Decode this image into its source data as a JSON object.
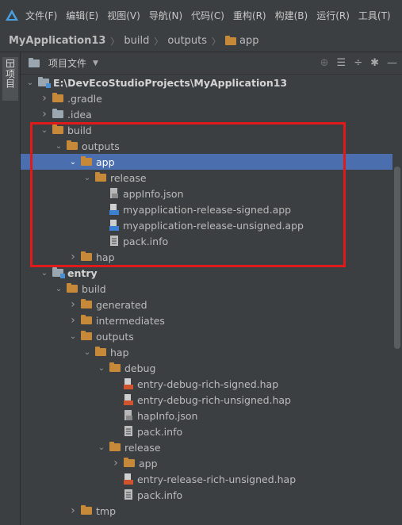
{
  "menu": [
    "文件(F)",
    "编辑(E)",
    "视图(V)",
    "导航(N)",
    "代码(C)",
    "重构(R)",
    "构建(B)",
    "运行(R)",
    "工具(T)"
  ],
  "breadcrumb": {
    "project": "MyApplication13",
    "items": [
      "build",
      "outputs",
      "app"
    ]
  },
  "sidebar": {
    "tab_label": "项目"
  },
  "panel": {
    "title": "项目文件"
  },
  "tree": [
    {
      "label": "E:\\DevEcoStudioProjects\\MyApplication13",
      "level": 0,
      "expanded": true,
      "icon": "module-folder",
      "bold": true
    },
    {
      "label": ".gradle",
      "level": 1,
      "expanded": false,
      "icon": "folder"
    },
    {
      "label": ".idea",
      "level": 1,
      "expanded": false,
      "icon": "folder-gray"
    },
    {
      "label": "build",
      "level": 1,
      "expanded": true,
      "icon": "folder"
    },
    {
      "label": "outputs",
      "level": 2,
      "expanded": true,
      "icon": "folder"
    },
    {
      "label": "app",
      "level": 3,
      "expanded": true,
      "icon": "folder",
      "selected": true
    },
    {
      "label": "release",
      "level": 4,
      "expanded": true,
      "icon": "folder"
    },
    {
      "label": "appInfo.json",
      "level": 5,
      "icon": "json-file"
    },
    {
      "label": "myapplication-release-signed.app",
      "level": 5,
      "icon": "app-file"
    },
    {
      "label": "myapplication-release-unsigned.app",
      "level": 5,
      "icon": "app-file"
    },
    {
      "label": "pack.info",
      "level": 5,
      "icon": "text-file"
    },
    {
      "label": "hap",
      "level": 3,
      "expanded": false,
      "icon": "folder"
    },
    {
      "label": "entry",
      "level": 1,
      "expanded": true,
      "icon": "module-folder",
      "bold": true
    },
    {
      "label": "build",
      "level": 2,
      "expanded": true,
      "icon": "folder"
    },
    {
      "label": "generated",
      "level": 3,
      "expanded": false,
      "icon": "folder"
    },
    {
      "label": "intermediates",
      "level": 3,
      "expanded": false,
      "icon": "folder"
    },
    {
      "label": "outputs",
      "level": 3,
      "expanded": true,
      "icon": "folder"
    },
    {
      "label": "hap",
      "level": 4,
      "expanded": true,
      "icon": "folder"
    },
    {
      "label": "debug",
      "level": 5,
      "expanded": true,
      "icon": "folder"
    },
    {
      "label": "entry-debug-rich-signed.hap",
      "level": 6,
      "icon": "hap-file"
    },
    {
      "label": "entry-debug-rich-unsigned.hap",
      "level": 6,
      "icon": "hap-file"
    },
    {
      "label": "hapInfo.json",
      "level": 6,
      "icon": "json-file"
    },
    {
      "label": "pack.info",
      "level": 6,
      "icon": "text-file"
    },
    {
      "label": "release",
      "level": 5,
      "expanded": true,
      "icon": "folder"
    },
    {
      "label": "app",
      "level": 6,
      "expanded": false,
      "icon": "folder"
    },
    {
      "label": "entry-release-rich-unsigned.hap",
      "level": 6,
      "icon": "hap-file"
    },
    {
      "label": "pack.info",
      "level": 6,
      "icon": "text-file"
    },
    {
      "label": "tmp",
      "level": 3,
      "expanded": false,
      "icon": "folder"
    }
  ],
  "colors": {
    "selection": "#4b6eaf",
    "highlight_box": "#e0191b",
    "folder": "#c6893a"
  }
}
